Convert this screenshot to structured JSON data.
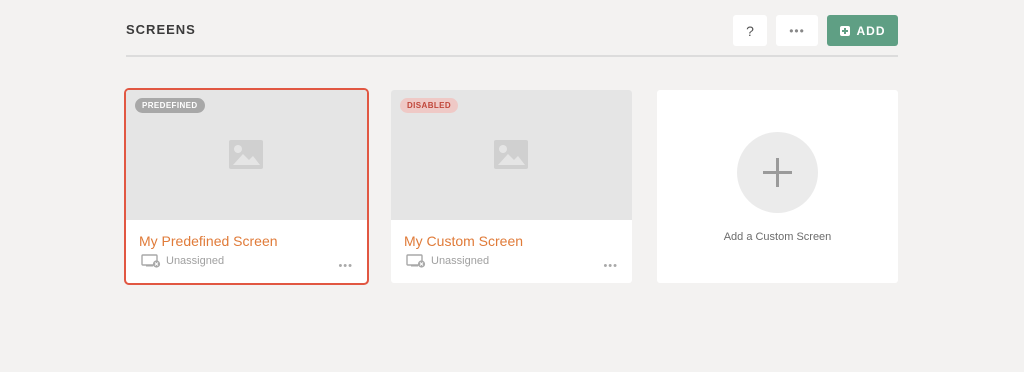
{
  "header": {
    "title": "SCREENS",
    "help_label": "?",
    "more_label": "•••",
    "add_label": "ADD"
  },
  "cards": [
    {
      "badge": "PREDEFINED",
      "title": "My Predefined Screen",
      "status": "Unassigned",
      "more_label": "•••",
      "selected": true
    },
    {
      "badge": "DISABLED",
      "title": "My Custom Screen",
      "status": "Unassigned",
      "more_label": "•••",
      "selected": false
    }
  ],
  "add_card": {
    "label": "Add a Custom Screen"
  },
  "colors": {
    "accent_orange": "#e07b39",
    "add_button_green": "#5f9f84",
    "selected_outline": "#e15742",
    "disabled_badge_text": "#c0463a"
  },
  "icons": [
    "image-placeholder-icon",
    "monitor-icon",
    "plus-icon"
  ]
}
